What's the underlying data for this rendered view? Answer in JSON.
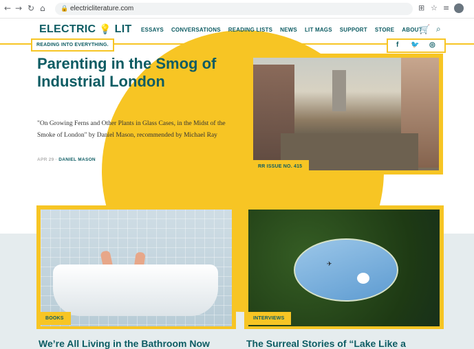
{
  "browser": {
    "url": "electricliterature.com",
    "nav_icons": [
      "back-arrow-icon",
      "forward-arrow-icon",
      "reload-icon",
      "home-icon"
    ],
    "extension_icons": [
      "translate-icon",
      "star-icon",
      "playlist-icon"
    ]
  },
  "header": {
    "logo_left": "ELECTRIC",
    "logo_bulb": "💡",
    "logo_right": "LIT",
    "nav": [
      "ESSAYS",
      "CONVERSATIONS",
      "READING LISTS",
      "NEWS",
      "LIT MAGS",
      "SUPPORT",
      "STORE",
      "ABOUT"
    ],
    "tagline": "READING INTO EVERYTHING.",
    "social": [
      "f",
      "🐦",
      "◎"
    ]
  },
  "hero": {
    "headline": "Parenting in the Smog of Industrial London",
    "subtitle": "\"On Growing Ferns and Other Plants in Glass Cases, in the Midst of the Smoke of London\" by Daniel Mason, recommended by Michael Ray",
    "date": "APR 29 ·",
    "author": "DANIEL MASON",
    "badge": "RR ISSUE NO. 415"
  },
  "cards": [
    {
      "badge": "BOOKS",
      "title": "We’re All Living in the Bathroom Now"
    },
    {
      "badge": "INTERVIEWS",
      "title": "The Surreal Stories of “Lake Like a"
    }
  ],
  "colors": {
    "accent": "#f7c524",
    "brand": "#0d5c63"
  }
}
